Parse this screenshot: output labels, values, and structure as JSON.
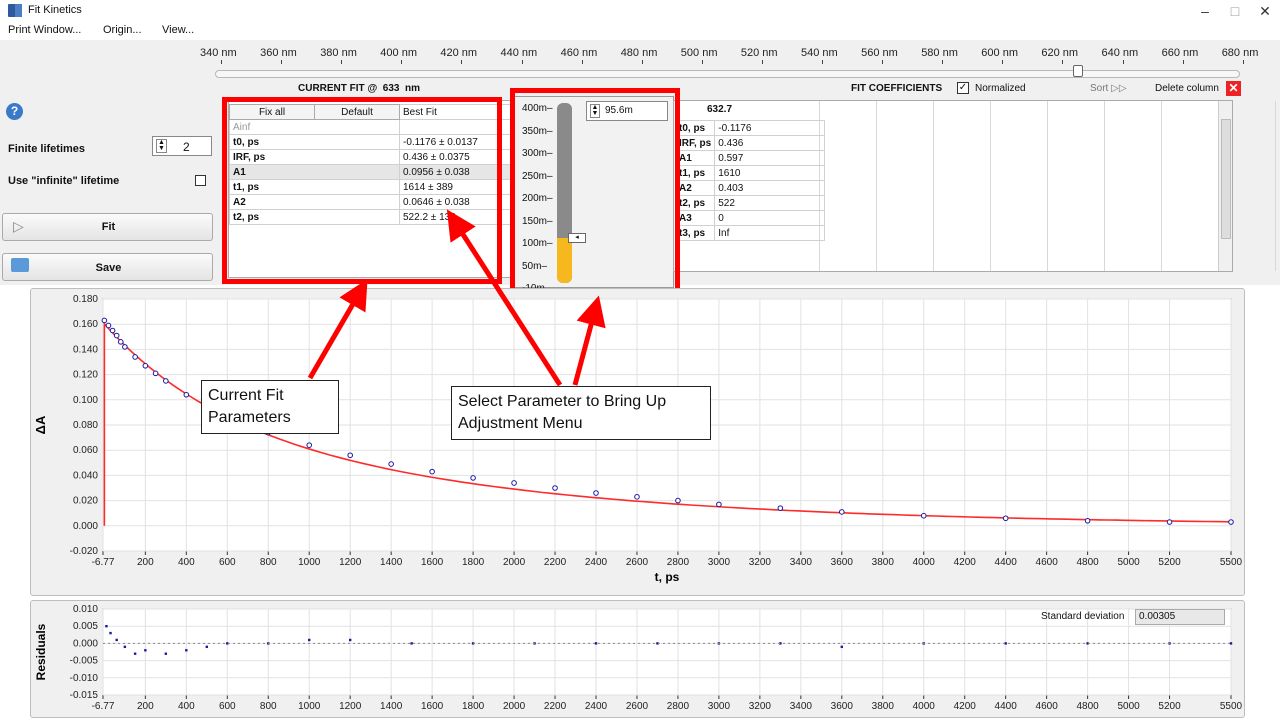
{
  "window": {
    "title": "Fit Kinetics",
    "min": "–",
    "max": "□",
    "close": "✕"
  },
  "menu": [
    "Print Window...",
    "Origin...",
    "View..."
  ],
  "wavelength_ruler": {
    "labels": [
      "340 nm",
      "360 nm",
      "380 nm",
      "400 nm",
      "420 nm",
      "440 nm",
      "460 nm",
      "480 nm",
      "500 nm",
      "520 nm",
      "540 nm",
      "560 nm",
      "580 nm",
      "600 nm",
      "620 nm",
      "640 nm",
      "660 nm",
      "680 nm"
    ],
    "selected": "633"
  },
  "left_panel": {
    "help": "?",
    "finite_lifetimes_label": "Finite lifetimes",
    "finite_lifetimes_value": "2",
    "infinite_label": "Use \"infinite\" lifetime",
    "fit_label": "Fit",
    "save_label": "Save"
  },
  "current_fit": {
    "header_prefix": "CURRENT FIT @",
    "header_value": "633",
    "header_unit": "nm",
    "buttons": [
      "Fix all",
      "Default"
    ],
    "best_fit_header": "Best Fit",
    "rows": [
      {
        "name": "Ainf",
        "value": ""
      },
      {
        "name": "t0, ps",
        "value": "-0.1176 ± 0.0137"
      },
      {
        "name": "IRF, ps",
        "value": "0.436 ± 0.0375"
      },
      {
        "name": "A1",
        "value": "0.0956 ± 0.038"
      },
      {
        "name": "t1, ps",
        "value": "1614 ± 389"
      },
      {
        "name": "A2",
        "value": "0.0646 ± 0.038"
      },
      {
        "name": "t2, ps",
        "value": "522.2 ± 138"
      }
    ]
  },
  "adjust_popup": {
    "spin_value": "95.6m",
    "scale": [
      "400m",
      "350m",
      "300m",
      "250m",
      "200m",
      "150m",
      "100m",
      "50m",
      "-10m"
    ],
    "level_fraction": 0.25
  },
  "fit_coefficients": {
    "header": "FIT COEFFICIENTS",
    "normalized_label": "Normalized",
    "sort_label": "Sort",
    "delete_label": "Delete column",
    "column_header": "632.7",
    "rows": [
      {
        "name": "t0, ps",
        "value": "-0.1176"
      },
      {
        "name": "IRF, ps",
        "value": "0.436"
      },
      {
        "name": "A1",
        "value": "0.597"
      },
      {
        "name": "t1, ps",
        "value": "1610"
      },
      {
        "name": "A2",
        "value": "0.403"
      },
      {
        "name": "t2, ps",
        "value": "522"
      },
      {
        "name": "A3",
        "value": "0"
      },
      {
        "name": "t3, ps",
        "value": "Inf"
      }
    ]
  },
  "callouts": {
    "current_fit": "Current Fit Parameters",
    "adjust": "Select Parameter to Bring Up Adjustment Menu"
  },
  "residuals": {
    "std_label": "Standard deviation",
    "std_value": "0.00305",
    "ylabel": "Residuals"
  },
  "chart_data": [
    {
      "type": "scatter",
      "title": "",
      "xlabel": "t, ps",
      "ylabel": "ΔA",
      "xlim": [
        -6.77,
        5500
      ],
      "ylim": [
        -0.02,
        0.18
      ],
      "x_ticks": [
        "-6.77",
        "200",
        "400",
        "600",
        "800",
        "1000",
        "1200",
        "1400",
        "1600",
        "1800",
        "2000",
        "2200",
        "2400",
        "2600",
        "2800",
        "3000",
        "3200",
        "3400",
        "3600",
        "3800",
        "4000",
        "4200",
        "4400",
        "4600",
        "4800",
        "5000",
        "5200",
        "5500"
      ],
      "y_ticks": [
        "0.180",
        "0.160",
        "0.140",
        "0.120",
        "0.100",
        "0.080",
        "0.060",
        "0.040",
        "0.020",
        "0.000",
        "-0.020"
      ],
      "fit_model": {
        "A1": 0.0956,
        "t1": 1614,
        "A2": 0.0646,
        "t2": 522.2
      },
      "points": [
        [
          0,
          0.163
        ],
        [
          20,
          0.159
        ],
        [
          40,
          0.155
        ],
        [
          60,
          0.151
        ],
        [
          80,
          0.146
        ],
        [
          100,
          0.142
        ],
        [
          150,
          0.134
        ],
        [
          200,
          0.127
        ],
        [
          250,
          0.121
        ],
        [
          300,
          0.115
        ],
        [
          400,
          0.104
        ],
        [
          500,
          0.095
        ],
        [
          600,
          0.087
        ],
        [
          700,
          0.08
        ],
        [
          800,
          0.074
        ],
        [
          1000,
          0.064
        ],
        [
          1200,
          0.056
        ],
        [
          1400,
          0.049
        ],
        [
          1600,
          0.043
        ],
        [
          1800,
          0.038
        ],
        [
          2000,
          0.034
        ],
        [
          2200,
          0.03
        ],
        [
          2400,
          0.026
        ],
        [
          2600,
          0.023
        ],
        [
          2800,
          0.02
        ],
        [
          3000,
          0.017
        ],
        [
          3300,
          0.014
        ],
        [
          3600,
          0.011
        ],
        [
          4000,
          0.008
        ],
        [
          4400,
          0.006
        ],
        [
          4800,
          0.004
        ],
        [
          5200,
          0.003
        ],
        [
          5500,
          0.003
        ]
      ]
    },
    {
      "type": "scatter",
      "title": "",
      "xlabel": "",
      "ylabel": "Residuals",
      "xlim": [
        -6.77,
        5500
      ],
      "ylim": [
        -0.015,
        0.01
      ],
      "x_ticks": [
        "-6.77",
        "200",
        "400",
        "600",
        "800",
        "1000",
        "1200",
        "1400",
        "1600",
        "1800",
        "2000",
        "2200",
        "2400",
        "2600",
        "2800",
        "3000",
        "3200",
        "3400",
        "3600",
        "3800",
        "4000",
        "4200",
        "4400",
        "4600",
        "4800",
        "5000",
        "5200",
        "5500"
      ],
      "y_ticks": [
        "0.010",
        "0.005",
        "0.000",
        "-0.005",
        "-0.010",
        "-0.015"
      ],
      "points": [
        [
          10,
          0.005
        ],
        [
          30,
          0.003
        ],
        [
          60,
          0.001
        ],
        [
          100,
          -0.001
        ],
        [
          150,
          -0.003
        ],
        [
          200,
          -0.002
        ],
        [
          300,
          -0.003
        ],
        [
          400,
          -0.002
        ],
        [
          500,
          -0.001
        ],
        [
          600,
          0.0
        ],
        [
          800,
          0.0
        ],
        [
          1000,
          0.001
        ],
        [
          1200,
          0.001
        ],
        [
          1500,
          0.0
        ],
        [
          1800,
          0.0
        ],
        [
          2100,
          0.0
        ],
        [
          2400,
          0.0
        ],
        [
          2700,
          0.0
        ],
        [
          3000,
          0.0
        ],
        [
          3300,
          0.0
        ],
        [
          3600,
          -0.001
        ],
        [
          4000,
          0.0
        ],
        [
          4400,
          0.0
        ],
        [
          4800,
          0.0
        ],
        [
          5200,
          0.0
        ],
        [
          5500,
          0.0
        ]
      ]
    }
  ]
}
